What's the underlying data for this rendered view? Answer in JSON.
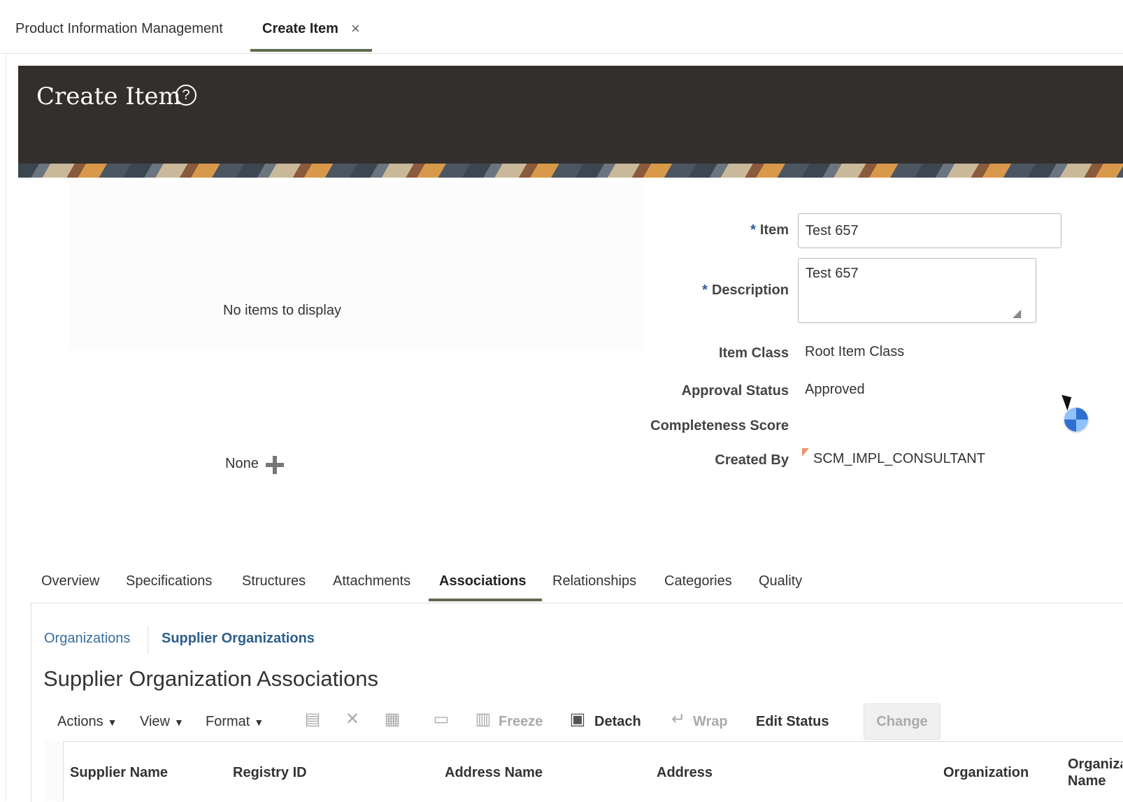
{
  "top_tabs": {
    "home_label": "Product Information Management",
    "current_label": "Create Item",
    "close_glyph": "×"
  },
  "header": {
    "title": "Create Item",
    "help_glyph": "?"
  },
  "left_panel": {
    "empty_text": "No items to display",
    "none_text": "None"
  },
  "form": {
    "item_label": "Item",
    "item_value": "Test 657",
    "description_label": "Description",
    "description_value": "Test 657",
    "item_class_label": "Item Class",
    "item_class_value": "Root Item Class",
    "approval_status_label": "Approval Status",
    "approval_status_value": "Approved",
    "completeness_label": "Completeness Score",
    "created_by_label": "Created By",
    "created_by_value": "SCM_IMPL_CONSULTANT",
    "required_marker": "*"
  },
  "detail_tabs": [
    "Overview",
    "Specifications",
    "Structures",
    "Attachments",
    "Associations",
    "Relationships",
    "Categories",
    "Quality"
  ],
  "detail_tabs_active": "Associations",
  "subtabs": [
    "Organizations",
    "Supplier Organizations"
  ],
  "section_title": "Supplier Organization Associations",
  "toolbar": {
    "actions": "Actions",
    "view": "View",
    "format": "Format",
    "caret": "▼",
    "freeze": "Freeze",
    "detach": "Detach",
    "wrap": "Wrap",
    "edit_status": "Edit Status",
    "change": "Change"
  },
  "table": {
    "columns": [
      "Supplier Name",
      "Registry ID",
      "Address Name",
      "Address",
      "Organization",
      "Organization Name"
    ]
  },
  "colors": {
    "banner": "#332f2c",
    "accent_underline": "#5f6b4f",
    "link": "#3a6d9a",
    "required": "#2b5b9a"
  },
  "icons": [
    "close-icon",
    "help-icon",
    "add-icon",
    "flag-icon",
    "cursor-icon",
    "busy-icon",
    "create-row-icon",
    "delete-icon",
    "columns-icon",
    "query-by-example-icon",
    "freeze-icon",
    "detach-icon",
    "wrap-icon",
    "resize-grip-icon"
  ]
}
